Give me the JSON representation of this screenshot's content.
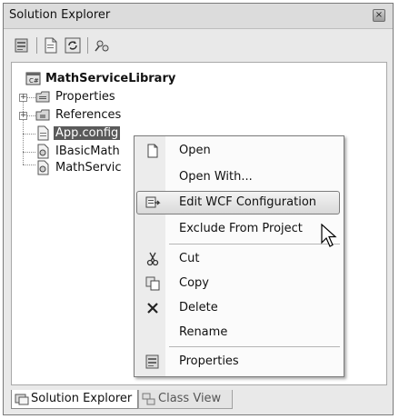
{
  "window": {
    "title": "Solution Explorer",
    "close_glyph": "×"
  },
  "toolbar": {
    "buttons": [
      "properties-icon",
      "show-all-files-icon",
      "refresh-icon",
      "view-class-diagram-icon"
    ]
  },
  "tree": {
    "project": "MathServiceLibrary",
    "items": [
      {
        "label": "Properties",
        "icon": "properties-folder-icon"
      },
      {
        "label": "References",
        "icon": "references-folder-icon"
      },
      {
        "label": "App.config",
        "icon": "config-file-icon"
      },
      {
        "label": "IBasicMath",
        "icon": "cs-file-icon"
      },
      {
        "label": "MathServic",
        "icon": "cs-file-icon"
      }
    ],
    "expander_glyph": "+"
  },
  "context_menu": {
    "items": [
      {
        "label": "Open",
        "icon": "open-icon"
      },
      {
        "label": "Open With...",
        "icon": ""
      },
      {
        "label": "Edit WCF Configuration",
        "icon": "wcf-config-icon"
      },
      {
        "label": "Exclude From Project",
        "icon": ""
      },
      {
        "label": "Cut",
        "icon": "cut-icon"
      },
      {
        "label": "Copy",
        "icon": "copy-icon"
      },
      {
        "label": "Delete",
        "icon": "delete-icon"
      },
      {
        "label": "Rename",
        "icon": ""
      },
      {
        "label": "Properties",
        "icon": "properties-icon"
      }
    ]
  },
  "tabs": [
    {
      "label": "Solution Explorer",
      "active": true
    },
    {
      "label": "Class View",
      "active": false
    }
  ]
}
